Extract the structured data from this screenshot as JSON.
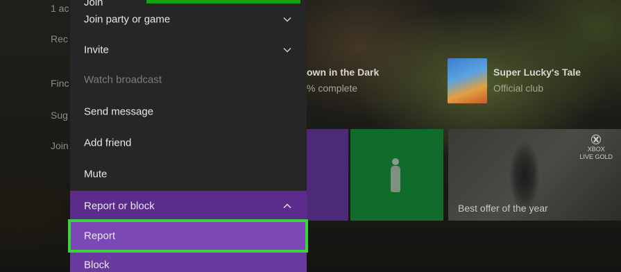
{
  "left_nav": {
    "items": [
      "1 ac",
      "Rec",
      "Finc",
      "Sug",
      "Join"
    ]
  },
  "home_tiles": {
    "game1_title": "own in the Dark",
    "game1_status": "% complete",
    "game2_title": "Super Lucky's Tale",
    "game2_subtitle": "Official club",
    "gold_caption": "Best offer of the year",
    "xbox_logo_top": "XBOX",
    "xbox_logo_bottom": "LIVE GOLD"
  },
  "menu": {
    "partial_top_label": "Join",
    "items": [
      {
        "label": "Join party or game",
        "state": "normal",
        "chevron": "down"
      },
      {
        "label": "Invite",
        "state": "normal",
        "chevron": "down"
      },
      {
        "label": "Watch broadcast",
        "state": "disabled"
      },
      {
        "label": "Send message",
        "state": "normal"
      },
      {
        "label": "Add friend",
        "state": "normal"
      },
      {
        "label": "Mute",
        "state": "normal"
      },
      {
        "label": "Report or block",
        "state": "expanded",
        "chevron": "up"
      },
      {
        "label": "Report",
        "state": "focused"
      },
      {
        "label": "Block",
        "state": "normal"
      }
    ]
  },
  "colors": {
    "menu_bg": "#262626",
    "report_block_bg": "#5c2c8c",
    "submenu_bg": "#6a3a9e",
    "focus_outline": "#3cd43c",
    "xbox_green": "#13a313"
  }
}
